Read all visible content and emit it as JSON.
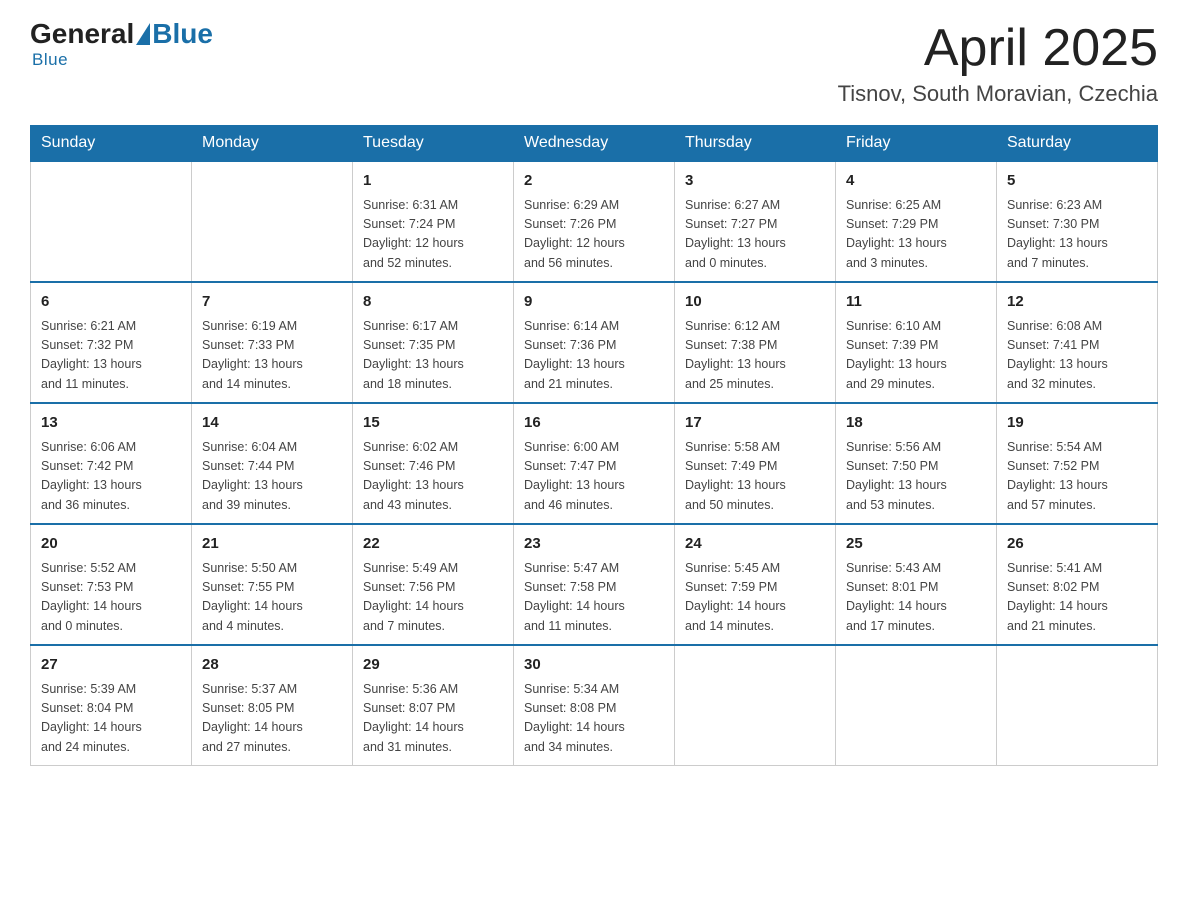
{
  "header": {
    "logo_general": "General",
    "logo_blue": "Blue",
    "month_title": "April 2025",
    "location": "Tisnov, South Moravian, Czechia"
  },
  "weekdays": [
    "Sunday",
    "Monday",
    "Tuesday",
    "Wednesday",
    "Thursday",
    "Friday",
    "Saturday"
  ],
  "weeks": [
    [
      {
        "day": "",
        "info": ""
      },
      {
        "day": "",
        "info": ""
      },
      {
        "day": "1",
        "info": "Sunrise: 6:31 AM\nSunset: 7:24 PM\nDaylight: 12 hours\nand 52 minutes."
      },
      {
        "day": "2",
        "info": "Sunrise: 6:29 AM\nSunset: 7:26 PM\nDaylight: 12 hours\nand 56 minutes."
      },
      {
        "day": "3",
        "info": "Sunrise: 6:27 AM\nSunset: 7:27 PM\nDaylight: 13 hours\nand 0 minutes."
      },
      {
        "day": "4",
        "info": "Sunrise: 6:25 AM\nSunset: 7:29 PM\nDaylight: 13 hours\nand 3 minutes."
      },
      {
        "day": "5",
        "info": "Sunrise: 6:23 AM\nSunset: 7:30 PM\nDaylight: 13 hours\nand 7 minutes."
      }
    ],
    [
      {
        "day": "6",
        "info": "Sunrise: 6:21 AM\nSunset: 7:32 PM\nDaylight: 13 hours\nand 11 minutes."
      },
      {
        "day": "7",
        "info": "Sunrise: 6:19 AM\nSunset: 7:33 PM\nDaylight: 13 hours\nand 14 minutes."
      },
      {
        "day": "8",
        "info": "Sunrise: 6:17 AM\nSunset: 7:35 PM\nDaylight: 13 hours\nand 18 minutes."
      },
      {
        "day": "9",
        "info": "Sunrise: 6:14 AM\nSunset: 7:36 PM\nDaylight: 13 hours\nand 21 minutes."
      },
      {
        "day": "10",
        "info": "Sunrise: 6:12 AM\nSunset: 7:38 PM\nDaylight: 13 hours\nand 25 minutes."
      },
      {
        "day": "11",
        "info": "Sunrise: 6:10 AM\nSunset: 7:39 PM\nDaylight: 13 hours\nand 29 minutes."
      },
      {
        "day": "12",
        "info": "Sunrise: 6:08 AM\nSunset: 7:41 PM\nDaylight: 13 hours\nand 32 minutes."
      }
    ],
    [
      {
        "day": "13",
        "info": "Sunrise: 6:06 AM\nSunset: 7:42 PM\nDaylight: 13 hours\nand 36 minutes."
      },
      {
        "day": "14",
        "info": "Sunrise: 6:04 AM\nSunset: 7:44 PM\nDaylight: 13 hours\nand 39 minutes."
      },
      {
        "day": "15",
        "info": "Sunrise: 6:02 AM\nSunset: 7:46 PM\nDaylight: 13 hours\nand 43 minutes."
      },
      {
        "day": "16",
        "info": "Sunrise: 6:00 AM\nSunset: 7:47 PM\nDaylight: 13 hours\nand 46 minutes."
      },
      {
        "day": "17",
        "info": "Sunrise: 5:58 AM\nSunset: 7:49 PM\nDaylight: 13 hours\nand 50 minutes."
      },
      {
        "day": "18",
        "info": "Sunrise: 5:56 AM\nSunset: 7:50 PM\nDaylight: 13 hours\nand 53 minutes."
      },
      {
        "day": "19",
        "info": "Sunrise: 5:54 AM\nSunset: 7:52 PM\nDaylight: 13 hours\nand 57 minutes."
      }
    ],
    [
      {
        "day": "20",
        "info": "Sunrise: 5:52 AM\nSunset: 7:53 PM\nDaylight: 14 hours\nand 0 minutes."
      },
      {
        "day": "21",
        "info": "Sunrise: 5:50 AM\nSunset: 7:55 PM\nDaylight: 14 hours\nand 4 minutes."
      },
      {
        "day": "22",
        "info": "Sunrise: 5:49 AM\nSunset: 7:56 PM\nDaylight: 14 hours\nand 7 minutes."
      },
      {
        "day": "23",
        "info": "Sunrise: 5:47 AM\nSunset: 7:58 PM\nDaylight: 14 hours\nand 11 minutes."
      },
      {
        "day": "24",
        "info": "Sunrise: 5:45 AM\nSunset: 7:59 PM\nDaylight: 14 hours\nand 14 minutes."
      },
      {
        "day": "25",
        "info": "Sunrise: 5:43 AM\nSunset: 8:01 PM\nDaylight: 14 hours\nand 17 minutes."
      },
      {
        "day": "26",
        "info": "Sunrise: 5:41 AM\nSunset: 8:02 PM\nDaylight: 14 hours\nand 21 minutes."
      }
    ],
    [
      {
        "day": "27",
        "info": "Sunrise: 5:39 AM\nSunset: 8:04 PM\nDaylight: 14 hours\nand 24 minutes."
      },
      {
        "day": "28",
        "info": "Sunrise: 5:37 AM\nSunset: 8:05 PM\nDaylight: 14 hours\nand 27 minutes."
      },
      {
        "day": "29",
        "info": "Sunrise: 5:36 AM\nSunset: 8:07 PM\nDaylight: 14 hours\nand 31 minutes."
      },
      {
        "day": "30",
        "info": "Sunrise: 5:34 AM\nSunset: 8:08 PM\nDaylight: 14 hours\nand 34 minutes."
      },
      {
        "day": "",
        "info": ""
      },
      {
        "day": "",
        "info": ""
      },
      {
        "day": "",
        "info": ""
      }
    ]
  ]
}
